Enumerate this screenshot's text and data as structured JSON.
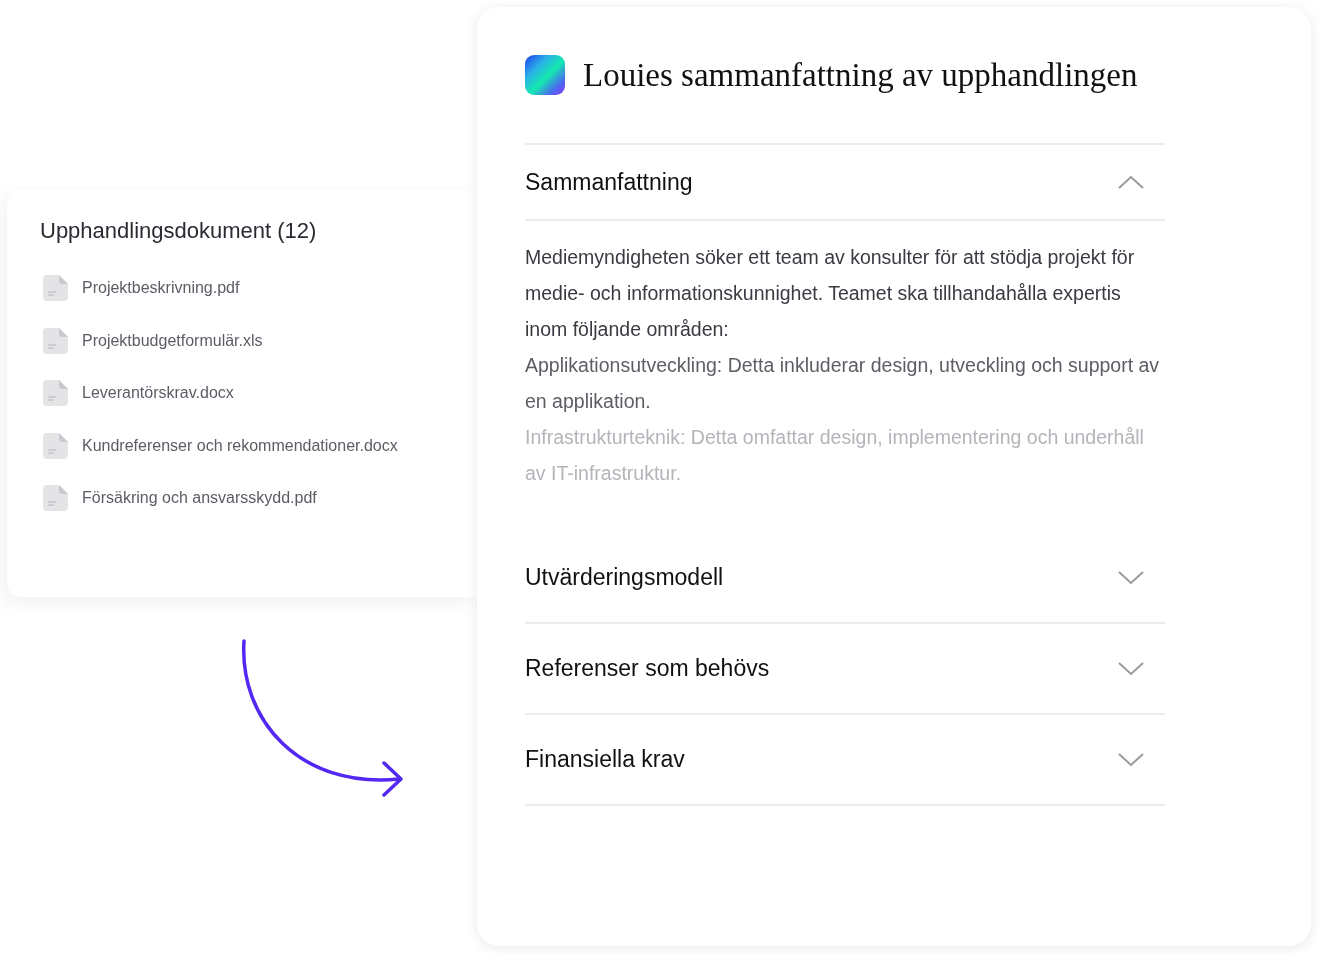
{
  "documents": {
    "title": "Upphandlingsdokument (12)",
    "files": [
      {
        "name": "Projektbeskrivning.pdf"
      },
      {
        "name": "Projektbudgetformulär.xls"
      },
      {
        "name": "Leverantörskrav.docx"
      },
      {
        "name": "Kundreferenser och rekommendationer.docx"
      },
      {
        "name": "Försäkring och ansvarsskydd.pdf"
      }
    ]
  },
  "summary": {
    "title": "Louies sammanfattning av upphandlingen",
    "sections": [
      {
        "title": "Sammanfattning",
        "expanded": true,
        "paragraphs": [
          "Mediemyndigheten söker ett team av konsulter för att stödja projekt för medie- och informationskunnighet. Teamet ska tillhandahålla expertis inom följande områden:",
          "Applikationsutveckling: Detta inkluderar design, utveckling och support av en applikation.",
          "Infrastrukturteknik: Detta omfattar design, implementering och underhåll av IT-infrastruktur."
        ]
      },
      {
        "title": "Utvärderingsmodell",
        "expanded": false
      },
      {
        "title": "Referenser som behövs",
        "expanded": false
      },
      {
        "title": "Finansiella krav",
        "expanded": false
      }
    ]
  }
}
